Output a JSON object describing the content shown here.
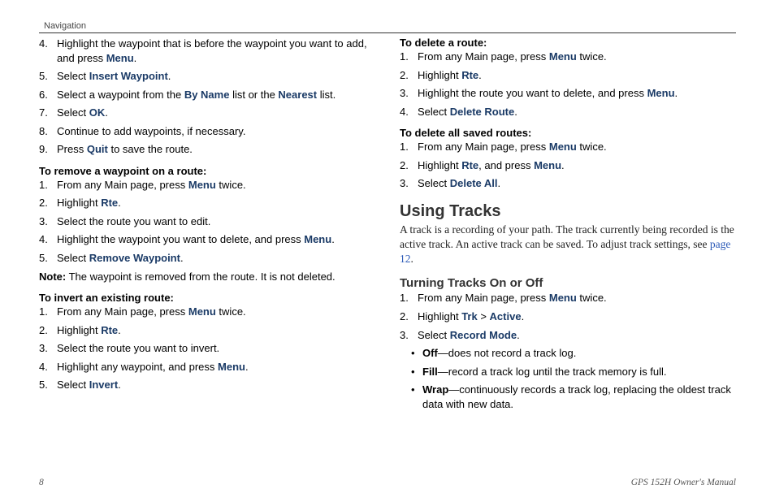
{
  "header": "Navigation",
  "footer_left": "8",
  "footer_right": "GPS 152H Owner's Manual",
  "left": {
    "cont_heading": null,
    "steps_cont": [
      {
        "pre": "Highlight the waypoint that is before the waypoint you want to add, and press ",
        "kw": "Menu",
        "post": "."
      },
      {
        "pre": "Select ",
        "kw": "Insert Waypoint",
        "post": "."
      },
      {
        "pre": "Select a waypoint from the ",
        "kw": "By Name",
        "mid": " list or the ",
        "kw2": "Nearest",
        "post": " list."
      },
      {
        "pre": "Select ",
        "kw": "OK",
        "post": "."
      },
      {
        "pre": "Continue to add waypoints, if necessary.",
        "kw": "",
        "post": ""
      },
      {
        "pre": "Press ",
        "kw": "Quit",
        "post": " to save the route."
      }
    ],
    "proc1_title": "To remove a waypoint on a route:",
    "proc1": [
      {
        "pre": "From any Main page, press ",
        "kw": "Menu",
        "post": " twice."
      },
      {
        "pre": "Highlight ",
        "kw": "Rte",
        "post": "."
      },
      {
        "pre": "Select the route you want to edit.",
        "kw": "",
        "post": ""
      },
      {
        "pre": "Highlight the waypoint you want to delete, and press ",
        "kw": "Menu",
        "post": "."
      },
      {
        "pre": "Select ",
        "kw": "Remove Waypoint",
        "post": "."
      }
    ],
    "note_label": "Note:",
    "note_text": " The waypoint is removed from the route. It is not deleted.",
    "proc2_title": "To invert an existing route:",
    "proc2": [
      {
        "pre": "From any Main page, press ",
        "kw": "Menu",
        "post": " twice."
      },
      {
        "pre": "Highlight ",
        "kw": "Rte",
        "post": "."
      },
      {
        "pre": "Select the route you want to invert.",
        "kw": "",
        "post": ""
      },
      {
        "pre": "Highlight any waypoint, and press ",
        "kw": "Menu",
        "post": "."
      },
      {
        "pre": "Select ",
        "kw": "Invert",
        "post": "."
      }
    ]
  },
  "right": {
    "proc3_title": "To delete a route:",
    "proc3": [
      {
        "pre": "From any Main page, press ",
        "kw": "Menu",
        "post": " twice."
      },
      {
        "pre": "Highlight ",
        "kw": "Rte",
        "post": "."
      },
      {
        "pre": "Highlight the route you want to delete, and press ",
        "kw": "Menu",
        "post": "."
      },
      {
        "pre": "Select ",
        "kw": "Delete Route",
        "post": "."
      }
    ],
    "proc4_title": "To delete all saved routes:",
    "proc4": [
      {
        "pre": "From any Main page, press ",
        "kw": "Menu",
        "post": " twice."
      },
      {
        "pre": "Highlight ",
        "kw": "Rte",
        "mid": ", and press ",
        "kw2": "Menu",
        "post": "."
      },
      {
        "pre": "Select ",
        "kw": "Delete All",
        "post": "."
      }
    ],
    "section_title": "Using Tracks",
    "section_body_a": "A track is a recording of your path. The track currently being recorded is the active track. An active track can be saved. To adjust track settings, see ",
    "section_link": "page 12",
    "section_body_b": ".",
    "subhead": "Turning Tracks On or Off",
    "proc5": [
      {
        "pre": "From any Main page, press ",
        "kw": "Menu",
        "post": " twice."
      },
      {
        "pre": "Highlight ",
        "kw": "Trk",
        "mid": " > ",
        "kw2": "Active",
        "post": "."
      },
      {
        "pre": "Select ",
        "kw": "Record Mode",
        "post": "."
      }
    ],
    "bullets": [
      {
        "kw": "Off",
        "text": "—does not record a track log."
      },
      {
        "kw": "Fill",
        "text": "—record a track log until the track memory is full."
      },
      {
        "kw": "Wrap",
        "text": "—continuously records a track log, replacing the oldest track data with new data."
      }
    ]
  }
}
